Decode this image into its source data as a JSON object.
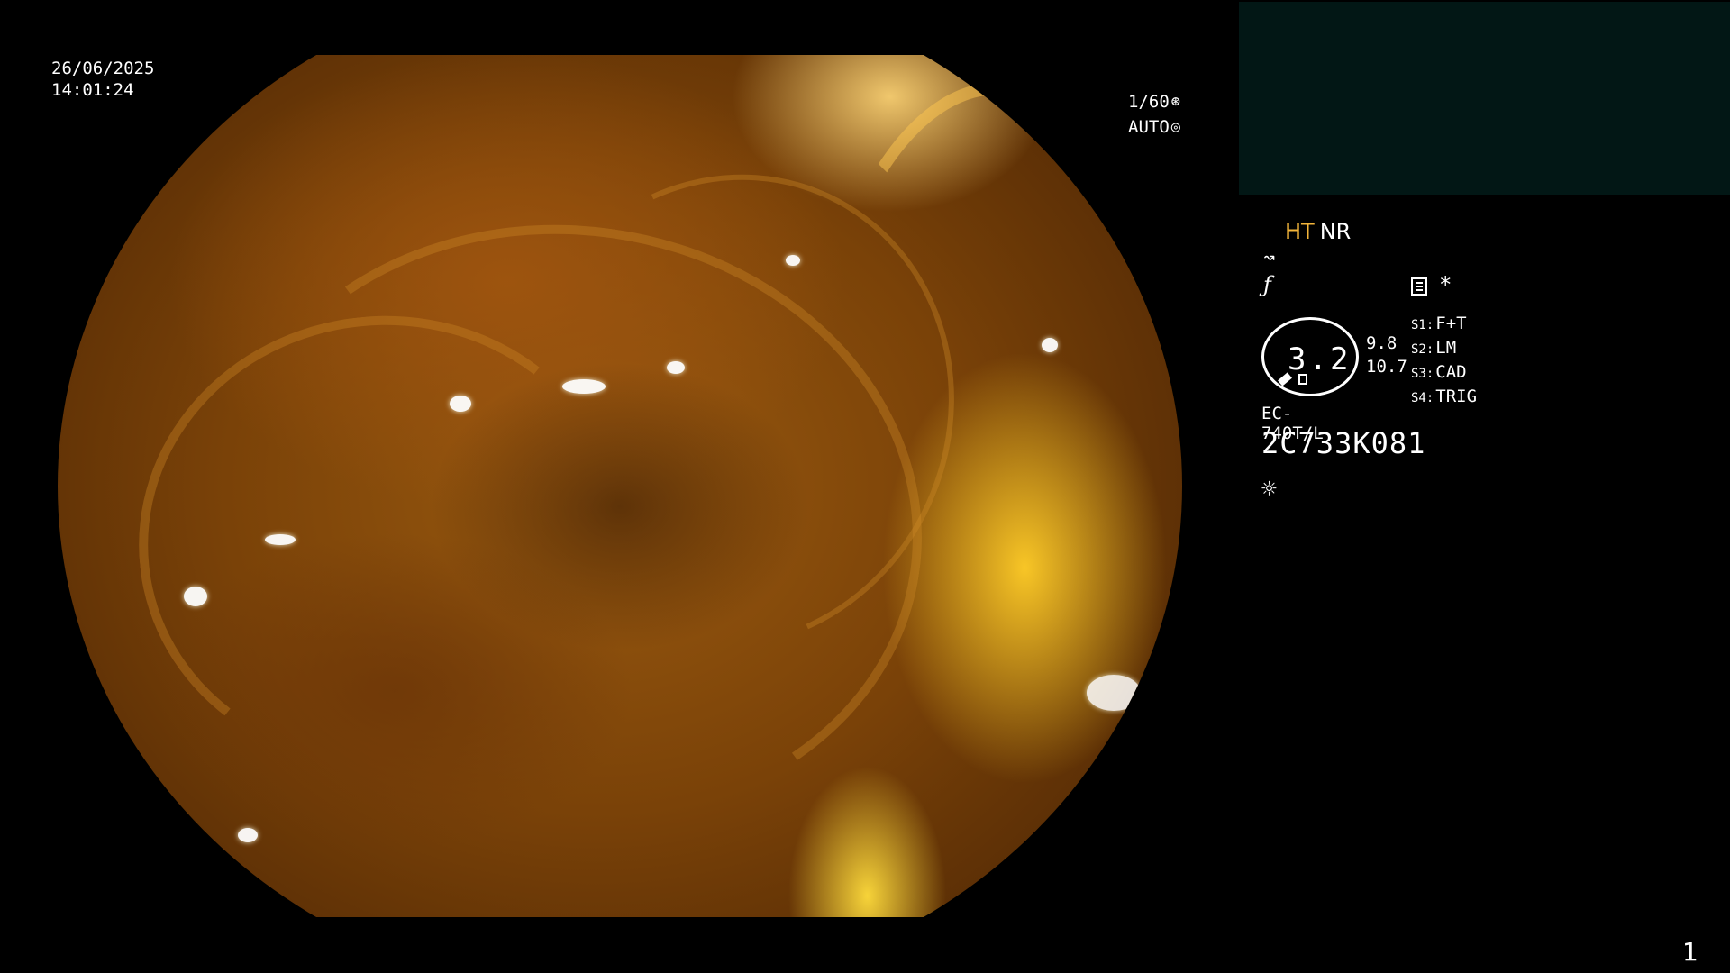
{
  "overlay": {
    "date": "26/06/2025",
    "time": "14:01:24",
    "shutter": "1/60",
    "shutter_icon": "aperture-icon",
    "exposure_mode": "AUTO",
    "exposure_icon": "iris-icon"
  },
  "modes": {
    "ht": "HT",
    "nr": "NR",
    "ht_color": "#f2b43a"
  },
  "icons": {
    "wave": "waveform-icon",
    "enhance": "enhance-f-icon",
    "doc": "document-icon",
    "asterisk": "*"
  },
  "zoom": {
    "value": "3.2",
    "focus_values": [
      "9.8",
      "10.7"
    ]
  },
  "switches": [
    {
      "key": "S1:",
      "value": "F+T"
    },
    {
      "key": "S2:",
      "value": "LM"
    },
    {
      "key": "S3:",
      "value": "CAD"
    },
    {
      "key": "S4:",
      "value": "TRIG"
    }
  ],
  "scope": {
    "model": "EC-740T/L",
    "serial": "2C733K081"
  },
  "light_icon": "sun-icon",
  "page_number": "1",
  "colors": {
    "background": "#000000",
    "thumbnail_panel": "#021715"
  }
}
